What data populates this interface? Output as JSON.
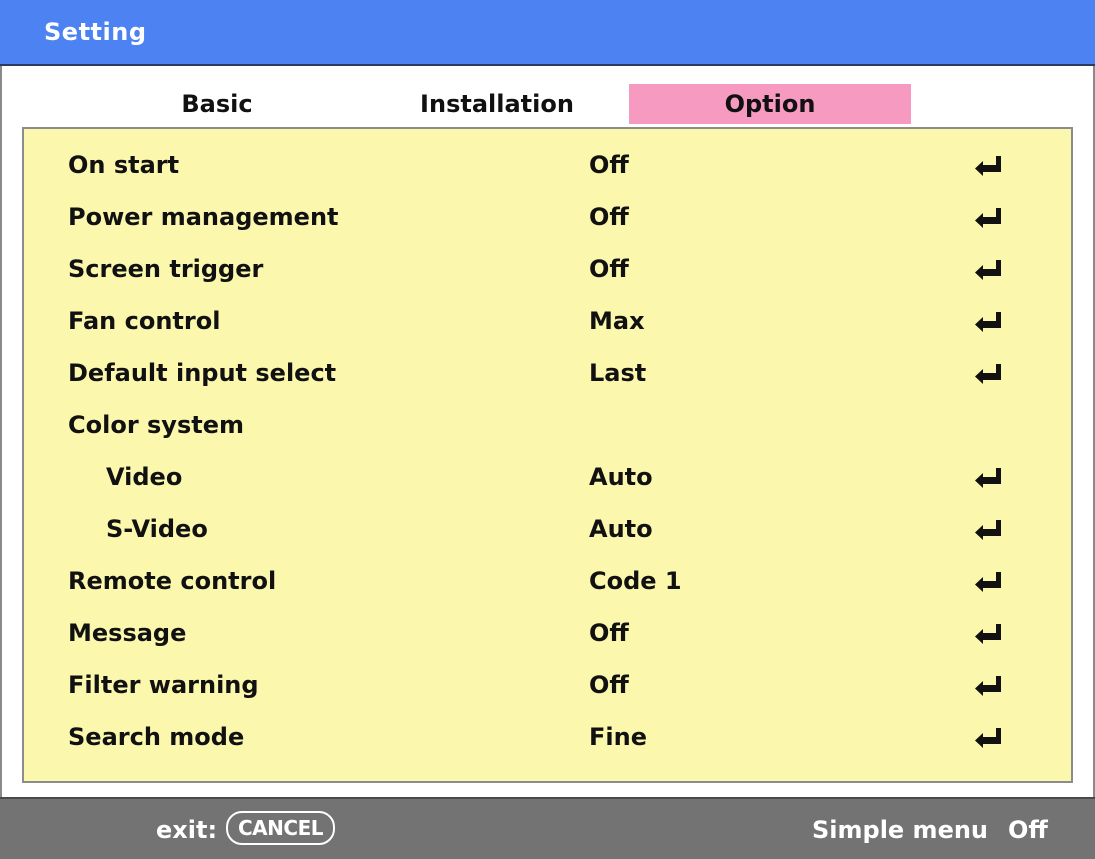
{
  "window": {
    "title": "Setting"
  },
  "tabs": [
    {
      "label": "Basic",
      "active": false
    },
    {
      "label": "Installation",
      "active": false
    },
    {
      "label": "Option",
      "active": true
    }
  ],
  "colors": {
    "title_bar": "#4d82f2",
    "active_tab": "#f79ac2",
    "panel": "#fbf7ad",
    "footer": "#737373"
  },
  "settings": [
    {
      "label": "On start",
      "value": "Off",
      "icon": "enter-icon"
    },
    {
      "label": "Power management",
      "value": "Off",
      "icon": "enter-icon"
    },
    {
      "label": "Screen trigger",
      "value": "Off",
      "icon": "enter-icon"
    },
    {
      "label": "Fan control",
      "value": "Max",
      "icon": "enter-icon"
    },
    {
      "label": "Default input select",
      "value": "Last",
      "icon": "enter-icon"
    },
    {
      "label": "Color system",
      "value": "",
      "icon": ""
    },
    {
      "label": "Video",
      "value": "Auto",
      "icon": "enter-icon"
    },
    {
      "label": "S-Video",
      "value": "Auto",
      "icon": "enter-icon"
    },
    {
      "label": "Remote control",
      "value": "Code 1",
      "icon": "enter-icon"
    },
    {
      "label": "Message",
      "value": "Off",
      "icon": "enter-icon"
    },
    {
      "label": "Filter warning",
      "value": "Off",
      "icon": "enter-icon"
    },
    {
      "label": "Search mode",
      "value": "Fine",
      "icon": "enter-icon"
    }
  ],
  "footer": {
    "exit_label": "exit:",
    "cancel_label": "CANCEL",
    "simple_menu_label": "Simple menu",
    "simple_menu_value": "Off"
  }
}
